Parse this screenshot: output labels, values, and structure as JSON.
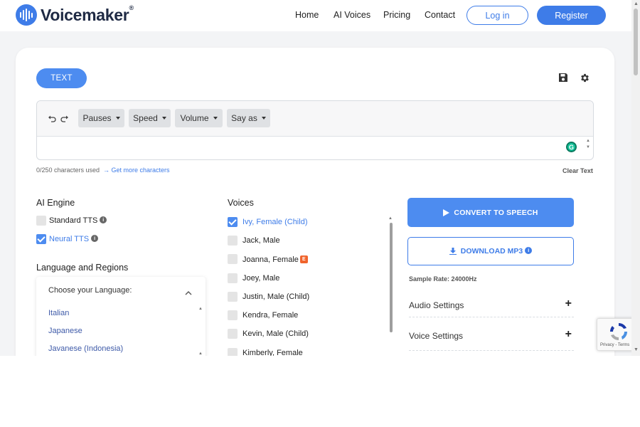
{
  "brand": {
    "name": "Voicemaker",
    "registered": "®",
    "color": "#3e7ce8"
  },
  "nav": {
    "items": [
      "Home",
      "AI Voices",
      "Pricing",
      "Contact"
    ],
    "login": "Log in",
    "register": "Register"
  },
  "tab": {
    "label": "TEXT"
  },
  "toolbar": {
    "dropdowns": [
      "Pauses",
      "Speed",
      "Volume",
      "Say as"
    ]
  },
  "editor": {
    "chars_used": "0/250 characters used",
    "more_chars": "Get more characters",
    "clear": "Clear Text"
  },
  "engine": {
    "title": "AI Engine",
    "options": [
      {
        "label": "Standard TTS",
        "checked": false
      },
      {
        "label": "Neural TTS",
        "checked": true
      }
    ]
  },
  "language": {
    "title": "Language and Regions",
    "placeholder": "Choose your Language:",
    "items": [
      "Italian",
      "Japanese",
      "Javanese (Indonesia)"
    ]
  },
  "voices": {
    "title": "Voices",
    "items": [
      {
        "label": "Ivy, Female (Child)",
        "checked": true
      },
      {
        "label": "Jack, Male",
        "checked": false
      },
      {
        "label": "Joanna, Female",
        "checked": false,
        "badge": "E"
      },
      {
        "label": "Joey, Male",
        "checked": false
      },
      {
        "label": "Justin, Male (Child)",
        "checked": false
      },
      {
        "label": "Kendra, Female",
        "checked": false
      },
      {
        "label": "Kevin, Male (Child)",
        "checked": false
      },
      {
        "label": "Kimberly, Female",
        "checked": false
      }
    ]
  },
  "actions": {
    "convert": "CONVERT TO SPEECH",
    "download": "DOWNLOAD MP3",
    "sample_rate": "Sample Rate: 24000Hz"
  },
  "accordions": [
    "Audio Settings",
    "Voice Settings"
  ],
  "recaptcha": {
    "links": "Privacy - Terms"
  }
}
